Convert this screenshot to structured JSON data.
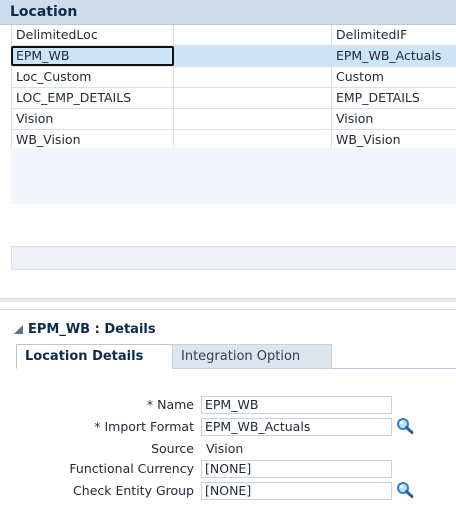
{
  "location": {
    "title": "Location",
    "rows": [
      {
        "name": "DelimitedLoc",
        "format": "DelimitedIF"
      },
      {
        "name": "EPM_WB",
        "format": "EPM_WB_Actuals"
      },
      {
        "name": "Loc_Custom",
        "format": "Custom"
      },
      {
        "name": "LOC_EMP_DETAILS",
        "format": "EMP_DETAILS"
      },
      {
        "name": "Vision",
        "format": "Vision"
      },
      {
        "name": "WB_Vision",
        "format": "WB_Vision"
      }
    ],
    "selected_index": 1
  },
  "details": {
    "title": "EPM_WB : Details",
    "tabs": [
      {
        "label": "Location Details",
        "active": true
      },
      {
        "label": "Integration Option",
        "active": false
      }
    ],
    "fields": {
      "name_label": "* Name",
      "name_value": "EPM_WB",
      "import_format_label": "* Import Format",
      "import_format_value": "EPM_WB_Actuals",
      "source_label": "Source",
      "source_value": "Vision",
      "functional_currency_label": "Functional Currency",
      "functional_currency_value": "[NONE]",
      "check_entity_group_label": "Check Entity Group",
      "check_entity_group_value": "[NONE]"
    }
  },
  "icons": {
    "search": "search-icon",
    "collapse": "collapse-triangle-icon"
  },
  "colors": {
    "header_bg": "#cfdcec",
    "selected_row": "#cce4f8",
    "accent_blue": "#2f7fc9"
  }
}
